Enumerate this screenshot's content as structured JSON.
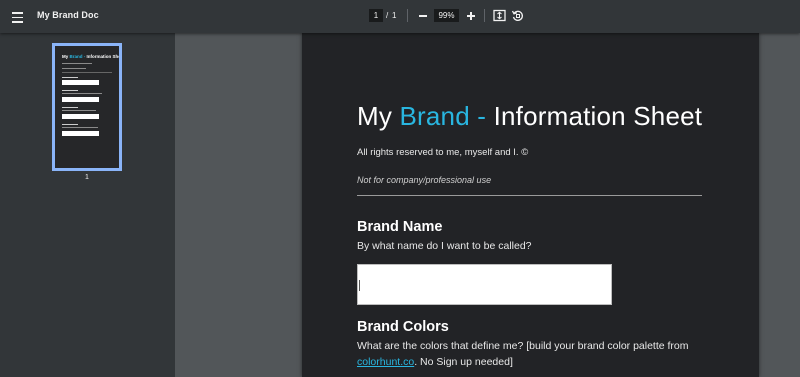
{
  "toolbar": {
    "title": "My Brand Doc",
    "current_page": "1",
    "page_separator": "/",
    "total_pages": "1",
    "zoom": "99%"
  },
  "sidebar": {
    "thumbnail_page_number": "1"
  },
  "document": {
    "title_part1": "My ",
    "title_accent": "Brand -",
    "title_part2": " Information Sheet",
    "rights": "All rights reserved to me, myself and I. ©",
    "note": "Not for company/professional use",
    "brand_name_heading": "Brand Name",
    "brand_name_question": "By what name do I want to be called?",
    "brand_colors_heading": "Brand Colors",
    "brand_colors_question_line1": "What are the colors that define me? [build your brand color palette from",
    "brand_colors_link": "colorhunt.co",
    "brand_colors_question_line2_rest": ". No Sign up needed]"
  },
  "colors": {
    "accent": "#29b6e0",
    "page_background": "#222326",
    "toolbar_background": "#323639",
    "viewer_background": "#525659",
    "thumbnail_selected_border": "#8ab4f8"
  }
}
